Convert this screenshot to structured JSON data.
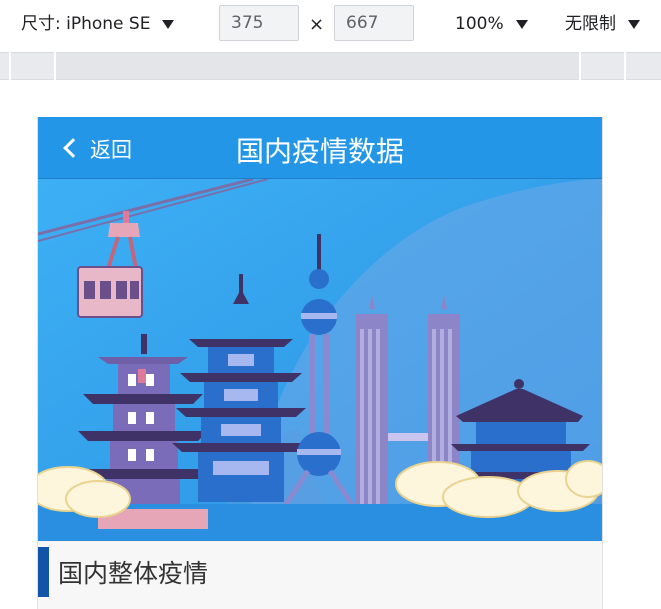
{
  "devtools": {
    "device_label": "尺寸: iPhone SE",
    "width_value": "375",
    "times": "×",
    "height_value": "667",
    "zoom": "100%",
    "throttle": "无限制"
  },
  "app": {
    "back_label": "返回",
    "title": "国内疫情数据",
    "section_title": "国内整体疫情"
  },
  "colors": {
    "navbar": "#2396e8",
    "section_accent": "#1254a8",
    "banner_sky": "#3aa2ec"
  }
}
